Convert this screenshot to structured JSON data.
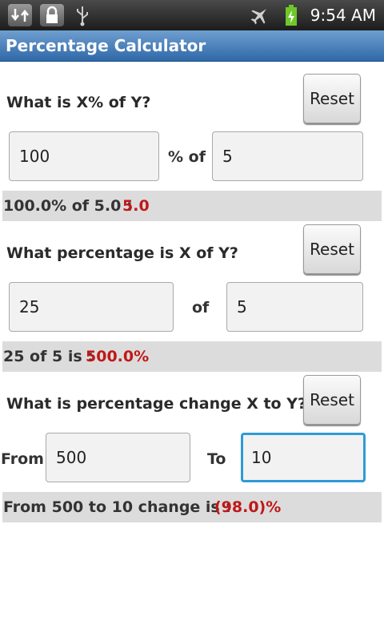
{
  "status_bar": {
    "time": "9:54 AM",
    "icons": [
      "sync-icon",
      "lock-icon",
      "usb-icon",
      "airplane-mode-icon",
      "battery-charging-icon"
    ]
  },
  "app": {
    "title": "Percentage Calculator"
  },
  "section1": {
    "question": "What is X%% of Y?",
    "reset_label": "Reset",
    "x_value": "100",
    "joiner": "% of",
    "y_value": "5",
    "result_text": "100.0% of 5.0 :",
    "result_value": "5.0"
  },
  "section2": {
    "question": "What percentage is X of Y?",
    "reset_label": "Reset",
    "x_value": "25",
    "joiner": "of",
    "y_value": "5",
    "result_text": "25 of 5 is :",
    "result_value": "500.0%"
  },
  "section3": {
    "question": "What is percentage change X to Y?",
    "reset_label": "Reset",
    "from_label": "From",
    "from_value": "500",
    "to_label": "To",
    "to_value": "10",
    "result_text": "From 500 to 10 change is :",
    "result_value": "(98.0)%"
  },
  "colors": {
    "title_bar": "#2f68a8",
    "result_value": "#c01818",
    "focus_border": "#2e9bd6"
  }
}
